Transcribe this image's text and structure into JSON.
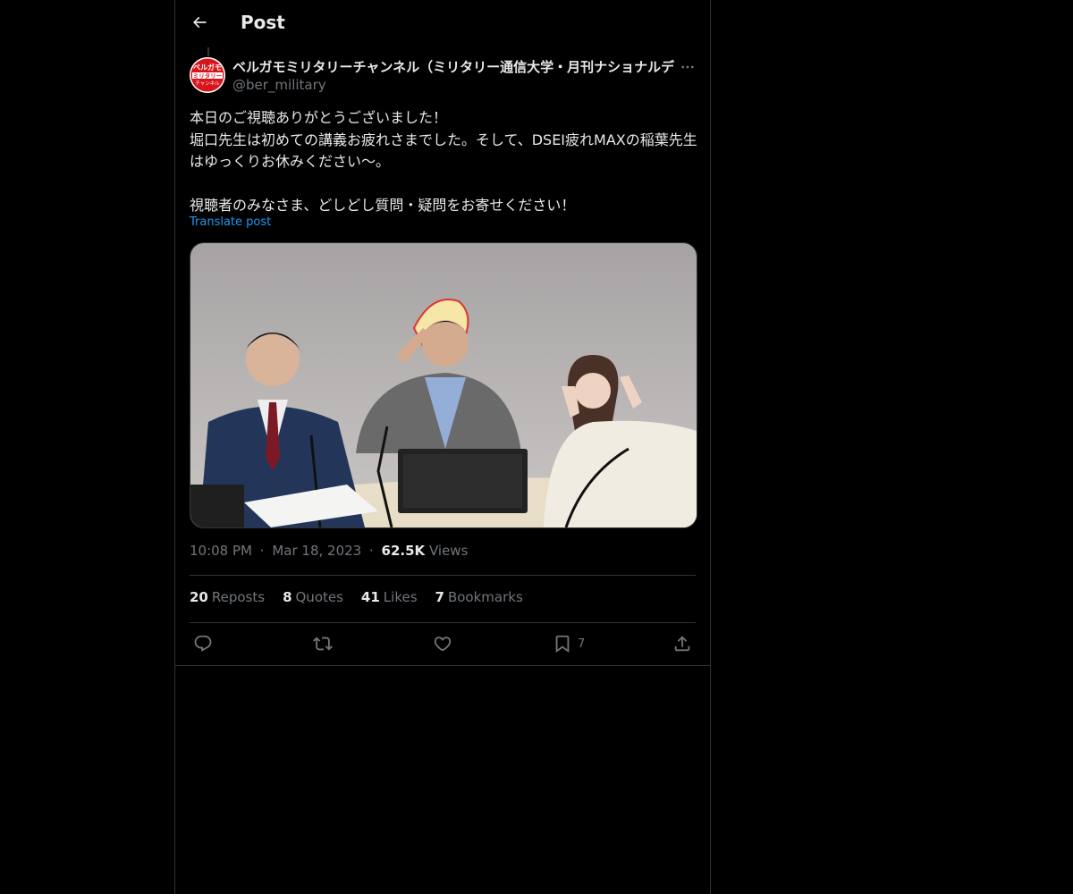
{
  "header": {
    "title": "Post"
  },
  "author": {
    "display_name": "ベルガモミリタリーチャンネル（ミリタリー通信大学・月刊ナショナルデ",
    "handle": "@ber_military",
    "avatar_text": [
      "ベルガモ",
      "ミリタリー",
      "チャンネル"
    ]
  },
  "post": {
    "lines": [
      "本日のご視聴ありがとうございました！",
      "堀口先生は初めての講義お疲れさまでした。そして、DSEI疲れMAXの稲葉先生はゆっくりお休みください〜。",
      "視聴者のみなさま、どしどし質問・疑問をお寄せください！"
    ],
    "translate_label": "Translate post"
  },
  "meta": {
    "time": "10:08 PM",
    "date": "Mar 18, 2023",
    "views_count": "62.5K",
    "views_label": "Views",
    "separator": "·"
  },
  "stats": [
    {
      "count": "20",
      "label": "Reposts"
    },
    {
      "count": "8",
      "label": "Quotes"
    },
    {
      "count": "41",
      "label": "Likes"
    },
    {
      "count": "7",
      "label": "Bookmarks"
    }
  ],
  "actions": {
    "bookmark_count": "7"
  },
  "colors": {
    "background": "#000000",
    "border": "#2f3336",
    "text_primary": "#e7e9ea",
    "text_secondary": "#71767b",
    "link": "#1d9bf0",
    "avatar_red": "#d7141a"
  }
}
